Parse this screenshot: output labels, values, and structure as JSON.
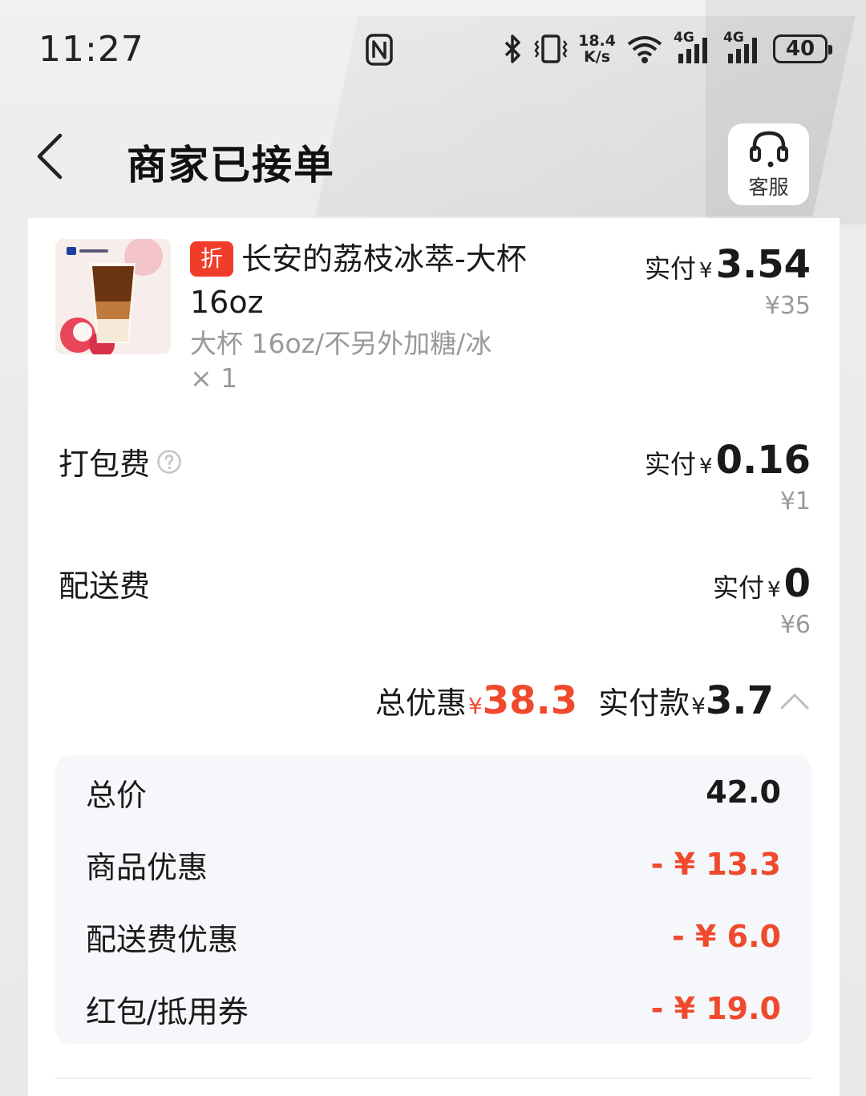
{
  "status_bar": {
    "time": "11:27",
    "speed_value": "18.4",
    "speed_unit": "K/s",
    "net1": "4G",
    "net2": "4G",
    "battery": "40"
  },
  "header": {
    "title": "商家已接单",
    "service_label": "客服"
  },
  "item": {
    "tag": "折",
    "name": "长安的荔枝冰萃-大杯16oz",
    "spec": "大杯 16oz/不另外加糖/冰",
    "qty": "× 1",
    "paid_label": "实付",
    "currency": "¥",
    "paid_amount": "3.54",
    "original_price": "¥35"
  },
  "packing_fee": {
    "label": "打包费",
    "paid_label": "实付",
    "currency": "¥",
    "paid_amount": "0.16",
    "original_price": "¥1"
  },
  "delivery_fee": {
    "label": "配送费",
    "paid_label": "实付",
    "currency": "¥",
    "paid_amount": "0",
    "original_price": "¥6"
  },
  "summary": {
    "discount_label": "总优惠",
    "currency": "¥",
    "discount_amount": "38.3",
    "paid_label": "实付款",
    "paid_amount": "3.7"
  },
  "breakdown": {
    "rows": [
      {
        "label": "总价",
        "value": "42.0"
      },
      {
        "label": "商品优惠",
        "value": "- ¥ 13.3"
      },
      {
        "label": "配送费优惠",
        "value": "- ¥ 6.0"
      },
      {
        "label": "红包/抵用券",
        "value": "- ¥ 19.0"
      }
    ]
  },
  "colors": {
    "accent_red": "#f04a2e",
    "tag_red": "#f23c2a",
    "muted_text": "#9a9a9a",
    "breakdown_bg": "#f5f7fa"
  }
}
